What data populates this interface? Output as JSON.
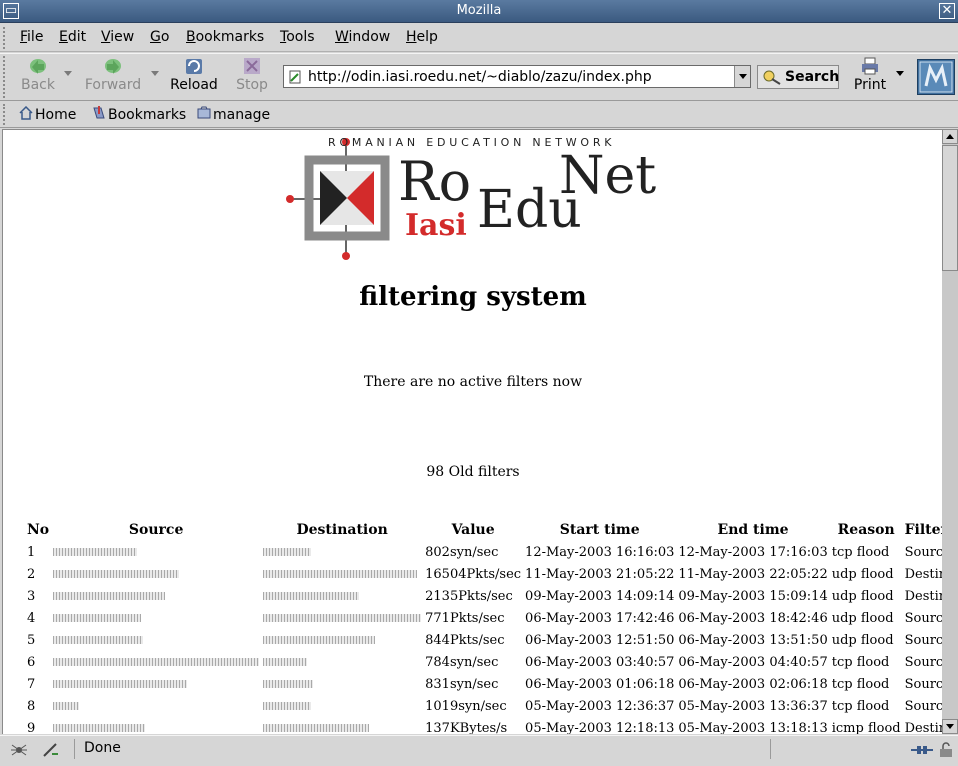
{
  "window": {
    "title": "Mozilla"
  },
  "menu": [
    "File",
    "Edit",
    "View",
    "Go",
    "Bookmarks",
    "Tools",
    "Window",
    "Help"
  ],
  "nav": {
    "back": "Back",
    "forward": "Forward",
    "reload": "Reload",
    "stop": "Stop",
    "url": "http://odin.iasi.roedu.net/~diablo/zazu/index.php",
    "search": "Search",
    "print": "Print"
  },
  "personal": {
    "home": "Home",
    "bookmarks": "Bookmarks",
    "manage": "manage"
  },
  "page": {
    "logo": {
      "network": "Romanian Education Network",
      "ro": "Ro",
      "edu": "Edu",
      "net": "Net",
      "iasi": "Iasi"
    },
    "heading": "filtering system",
    "notice": "There are no active filters now",
    "old_count": "98 Old filters",
    "columns": [
      "No",
      "Source",
      "Destination",
      "Value",
      "Start time",
      "End time",
      "Reason",
      "Filter on"
    ],
    "rows": [
      {
        "no": "1",
        "value": "802syn/sec",
        "start": "12-May-2003 16:16:03",
        "end": "12-May-2003 17:16:03",
        "reason": "tcp flood",
        "filter_on": "Source"
      },
      {
        "no": "2",
        "value": "16504Pkts/sec",
        "start": "11-May-2003 21:05:22",
        "end": "11-May-2003 22:05:22",
        "reason": "udp flood",
        "filter_on": "Destination"
      },
      {
        "no": "3",
        "value": "2135Pkts/sec",
        "start": "09-May-2003 14:09:14",
        "end": "09-May-2003 15:09:14",
        "reason": "udp flood",
        "filter_on": "Destination"
      },
      {
        "no": "4",
        "value": "771Pkts/sec",
        "start": "06-May-2003 17:42:46",
        "end": "06-May-2003 18:42:46",
        "reason": "udp flood",
        "filter_on": "Source"
      },
      {
        "no": "5",
        "value": "844Pkts/sec",
        "start": "06-May-2003 12:51:50",
        "end": "06-May-2003 13:51:50",
        "reason": "udp flood",
        "filter_on": "Source"
      },
      {
        "no": "6",
        "value": "784syn/sec",
        "start": "06-May-2003 03:40:57",
        "end": "06-May-2003 04:40:57",
        "reason": "tcp flood",
        "filter_on": "Source"
      },
      {
        "no": "7",
        "value": "831syn/sec",
        "start": "06-May-2003 01:06:18",
        "end": "06-May-2003 02:06:18",
        "reason": "tcp flood",
        "filter_on": "Source"
      },
      {
        "no": "8",
        "value": "1019syn/sec",
        "start": "05-May-2003 12:36:37",
        "end": "05-May-2003 13:36:37",
        "reason": "tcp flood",
        "filter_on": "Source"
      },
      {
        "no": "9",
        "value": "137KBytes/s",
        "start": "05-May-2003 12:18:13",
        "end": "05-May-2003 13:18:13",
        "reason": "icmp flood",
        "filter_on": "Destination"
      }
    ]
  },
  "status": {
    "text": "Done"
  },
  "colors": {
    "accent": "#d32b2b",
    "titlebar": "#4a6a90",
    "logo_dark": "#222222"
  },
  "icons": [
    "back-icon",
    "forward-icon",
    "reload-icon",
    "stop-icon",
    "search-icon",
    "print-icon",
    "home-icon",
    "bookmarks-icon",
    "manage-icon",
    "mozilla-logo-icon",
    "status-spider-icon",
    "status-security-icon",
    "online-icon",
    "lock-icon"
  ]
}
